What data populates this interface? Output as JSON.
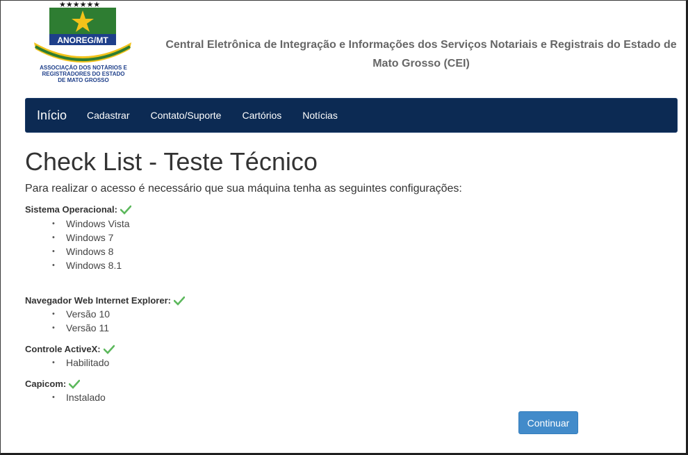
{
  "header": {
    "logo": {
      "name": "ANOREG/MT",
      "org": "ASSOCIAÇÃO DOS NOTÁRIOS E REGISTRADORES DO ESTADO DE MATO GROSSO"
    },
    "title_line1": "Central Eletrônica de Integração e Informações dos Serviços Notariais e Registrais do Estado de",
    "title_line2": "Mato Grosso (CEI)"
  },
  "nav": {
    "brand": "Início",
    "links": [
      "Cadastrar",
      "Contato/Suporte",
      "Cartórios",
      "Notícias"
    ],
    "background": "#0c2a53"
  },
  "main": {
    "title": "Check List - Teste Técnico",
    "intro": "Para realizar o acesso é necessário que sua máquina tenha as seguintes configurações:",
    "sections": [
      {
        "title": "Sistema Operacional:",
        "status_icon": "check-icon",
        "items": [
          "Windows Vista",
          "Windows 7",
          "Windows 8",
          "Windows 8.1"
        ]
      },
      {
        "title": "Navegador Web Internet Explorer:",
        "status_icon": "check-icon",
        "items": [
          "Versão 10",
          "Versão 11"
        ]
      },
      {
        "title": "Controle ActiveX:",
        "status_icon": "check-icon",
        "items": [
          "Habilitado"
        ]
      },
      {
        "title": "Capicom:",
        "status_icon": "check-icon",
        "items": [
          "Instalado"
        ]
      }
    ],
    "continue_label": "Continuar",
    "accent": "#428bca",
    "check_color": "#5cb85c"
  }
}
